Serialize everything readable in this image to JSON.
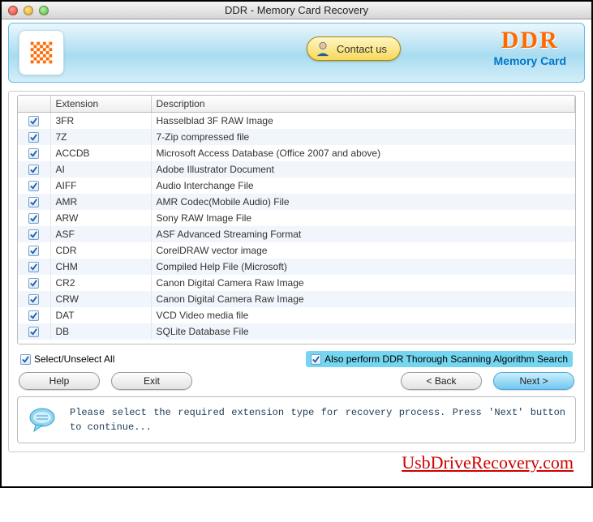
{
  "window": {
    "title": "DDR - Memory Card Recovery"
  },
  "banner": {
    "contact_label": "Contact us",
    "brand_main": "DDR",
    "brand_sub": "Memory Card"
  },
  "table": {
    "headers": {
      "col1": "",
      "col2": "Extension",
      "col3": "Description"
    },
    "rows": [
      {
        "ext": "3FR",
        "desc": "Hasselblad 3F RAW Image"
      },
      {
        "ext": "7Z",
        "desc": "7-Zip compressed file"
      },
      {
        "ext": "ACCDB",
        "desc": "Microsoft Access Database (Office 2007 and above)"
      },
      {
        "ext": "AI",
        "desc": "Adobe Illustrator Document"
      },
      {
        "ext": "AIFF",
        "desc": "Audio Interchange File"
      },
      {
        "ext": "AMR",
        "desc": "AMR Codec(Mobile Audio) File"
      },
      {
        "ext": "ARW",
        "desc": "Sony RAW Image File"
      },
      {
        "ext": "ASF",
        "desc": "ASF Advanced Streaming Format"
      },
      {
        "ext": "CDR",
        "desc": "CorelDRAW vector image"
      },
      {
        "ext": "CHM",
        "desc": "Compiled Help File (Microsoft)"
      },
      {
        "ext": "CR2",
        "desc": "Canon Digital Camera Raw Image"
      },
      {
        "ext": "CRW",
        "desc": "Canon Digital Camera Raw Image"
      },
      {
        "ext": "DAT",
        "desc": "VCD Video media file"
      },
      {
        "ext": "DB",
        "desc": "SQLite Database File"
      }
    ]
  },
  "options": {
    "select_all": "Select/Unselect All",
    "thorough": "Also perform DDR Thorough Scanning Algorithm Search"
  },
  "buttons": {
    "help": "Help",
    "exit": "Exit",
    "back": "< Back",
    "next": "Next >"
  },
  "info": {
    "text": "Please select the required extension type for recovery process. Press 'Next' button to continue..."
  },
  "footer": {
    "text": "UsbDriveRecovery.com"
  }
}
